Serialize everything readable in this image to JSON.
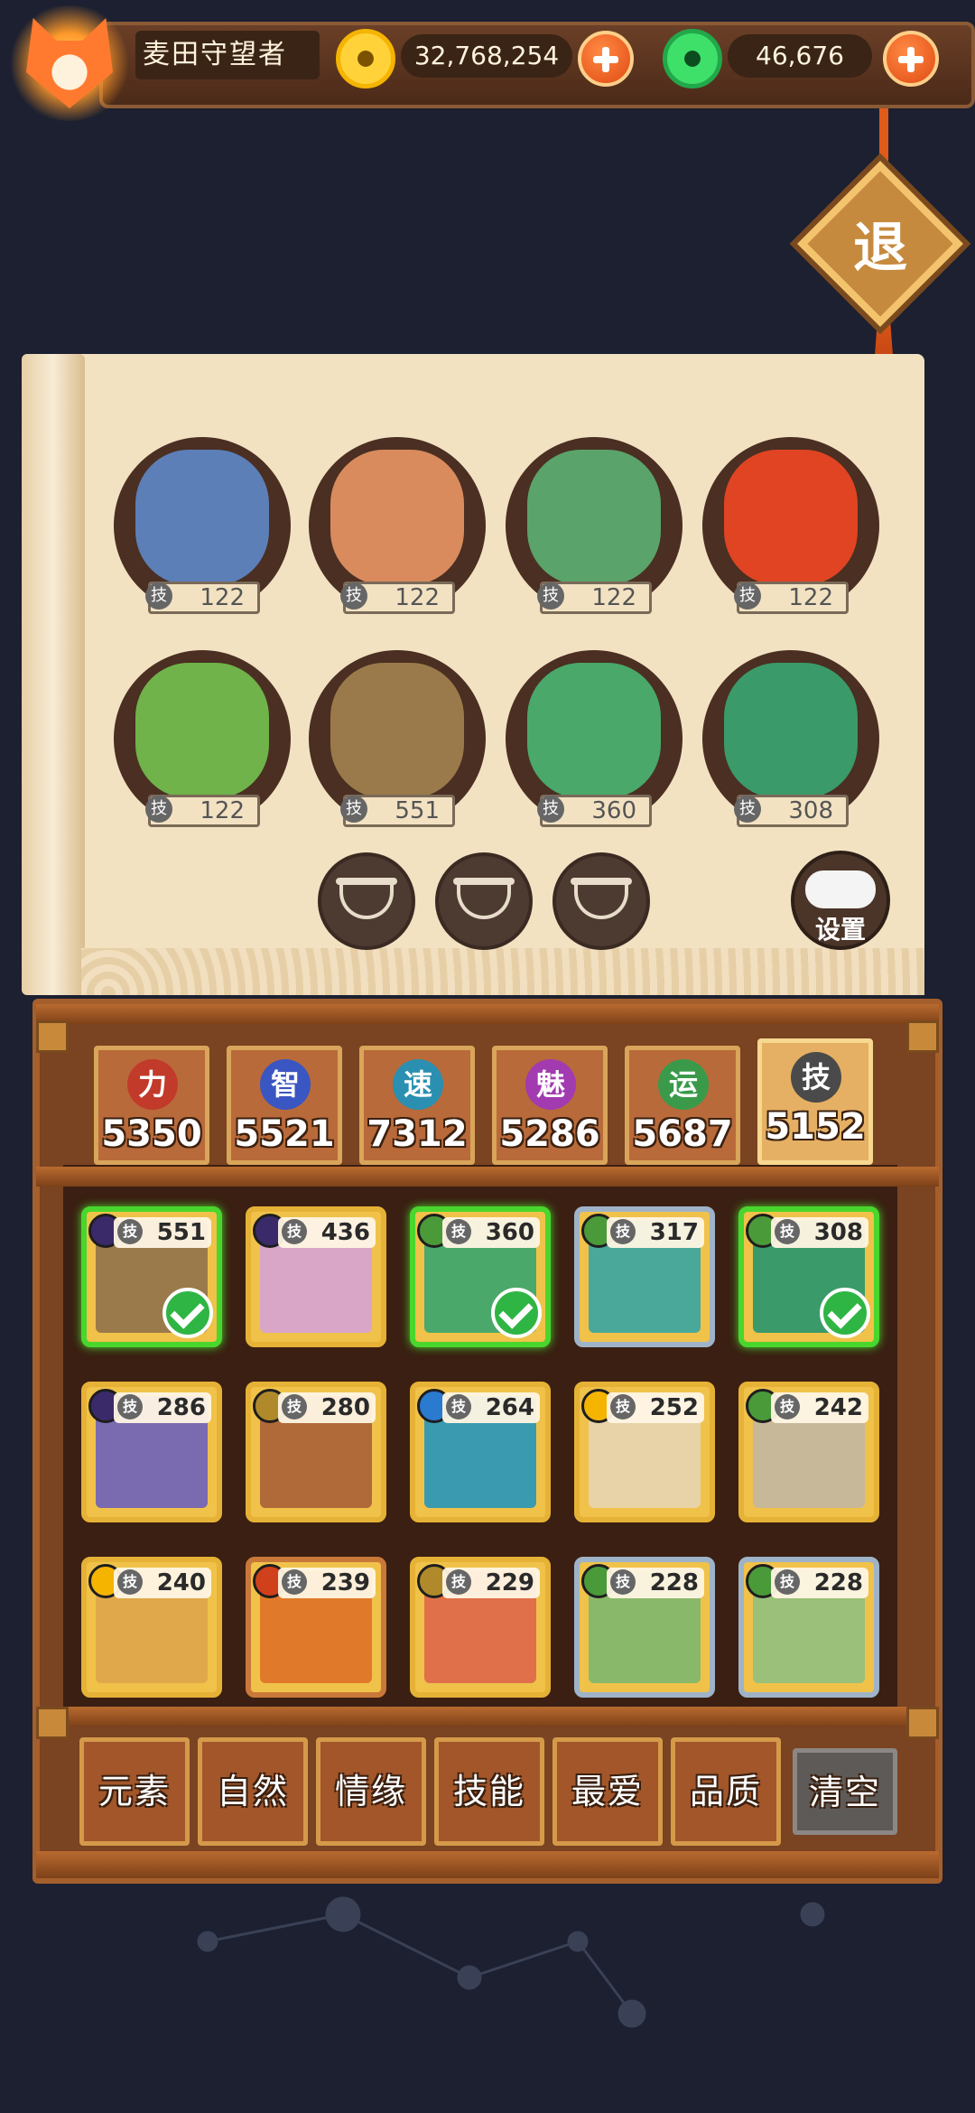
{
  "player": {
    "name": "麦田守望者"
  },
  "currency": {
    "gold": {
      "icon": "gold-coin-icon",
      "value": "32,768,254"
    },
    "jade": {
      "icon": "jade-coin-icon",
      "value": "46,676"
    }
  },
  "exit_label": "退",
  "team": [
    {
      "power": "122",
      "color": "#5c7fb8"
    },
    {
      "power": "122",
      "color": "#d98b5e"
    },
    {
      "power": "122",
      "color": "#5aa36a"
    },
    {
      "power": "122",
      "color": "#e04422"
    },
    {
      "power": "122",
      "color": "#6fb34a"
    },
    {
      "power": "551",
      "color": "#9a7a4a"
    },
    {
      "power": "360",
      "color": "#4aa86a"
    },
    {
      "power": "308",
      "color": "#3a9a6a"
    }
  ],
  "settings_label": "设置",
  "tech_glyph": "技",
  "stats": [
    {
      "label": "力",
      "value": "5350",
      "color": "#c23a2a"
    },
    {
      "label": "智",
      "value": "5521",
      "color": "#3a56c2"
    },
    {
      "label": "速",
      "value": "7312",
      "color": "#2a8fb0"
    },
    {
      "label": "魅",
      "value": "5286",
      "color": "#a23ab0"
    },
    {
      "label": "运",
      "value": "5687",
      "color": "#3a9a4a"
    },
    {
      "label": "技",
      "value": "5152",
      "color": "#4a4a4a"
    }
  ],
  "heroes": [
    {
      "power": "551",
      "elem": "#3a2a6a",
      "art": "#9a7a4a",
      "selected": true
    },
    {
      "power": "436",
      "elem": "#3a2a6a",
      "art": "#d9a6c8",
      "selected": false
    },
    {
      "power": "360",
      "elem": "#4a9a3a",
      "art": "#4aa86a",
      "selected": true
    },
    {
      "power": "317",
      "elem": "#4a9a3a",
      "art": "#4aa89a",
      "selected": false
    },
    {
      "power": "308",
      "elem": "#4a9a3a",
      "art": "#3a9a6a",
      "selected": true
    },
    {
      "power": "286",
      "elem": "#3a2a6a",
      "art": "#7a6ab0",
      "selected": false
    },
    {
      "power": "280",
      "elem": "#b08a2a",
      "art": "#b06a3a",
      "selected": false
    },
    {
      "power": "264",
      "elem": "#2a7ad0",
      "art": "#3a9ab0",
      "selected": false
    },
    {
      "power": "252",
      "elem": "#f4b400",
      "art": "#e8d2a8",
      "selected": false
    },
    {
      "power": "242",
      "elem": "#4a9a3a",
      "art": "#c8b89a",
      "selected": false
    },
    {
      "power": "240",
      "elem": "#f4b400",
      "art": "#e0a84a",
      "selected": false
    },
    {
      "power": "239",
      "elem": "#d0401a",
      "art": "#e07a2a",
      "selected": false
    },
    {
      "power": "229",
      "elem": "#b08a2a",
      "art": "#e0704a",
      "selected": false
    },
    {
      "power": "228",
      "elem": "#4a9a3a",
      "art": "#8ab86a",
      "selected": false
    },
    {
      "power": "228",
      "elem": "#4a9a3a",
      "art": "#9ac07a",
      "selected": false
    }
  ],
  "filters": [
    "元素",
    "自然",
    "情缘",
    "技能",
    "最爱",
    "品质"
  ],
  "clear_label": "清空"
}
